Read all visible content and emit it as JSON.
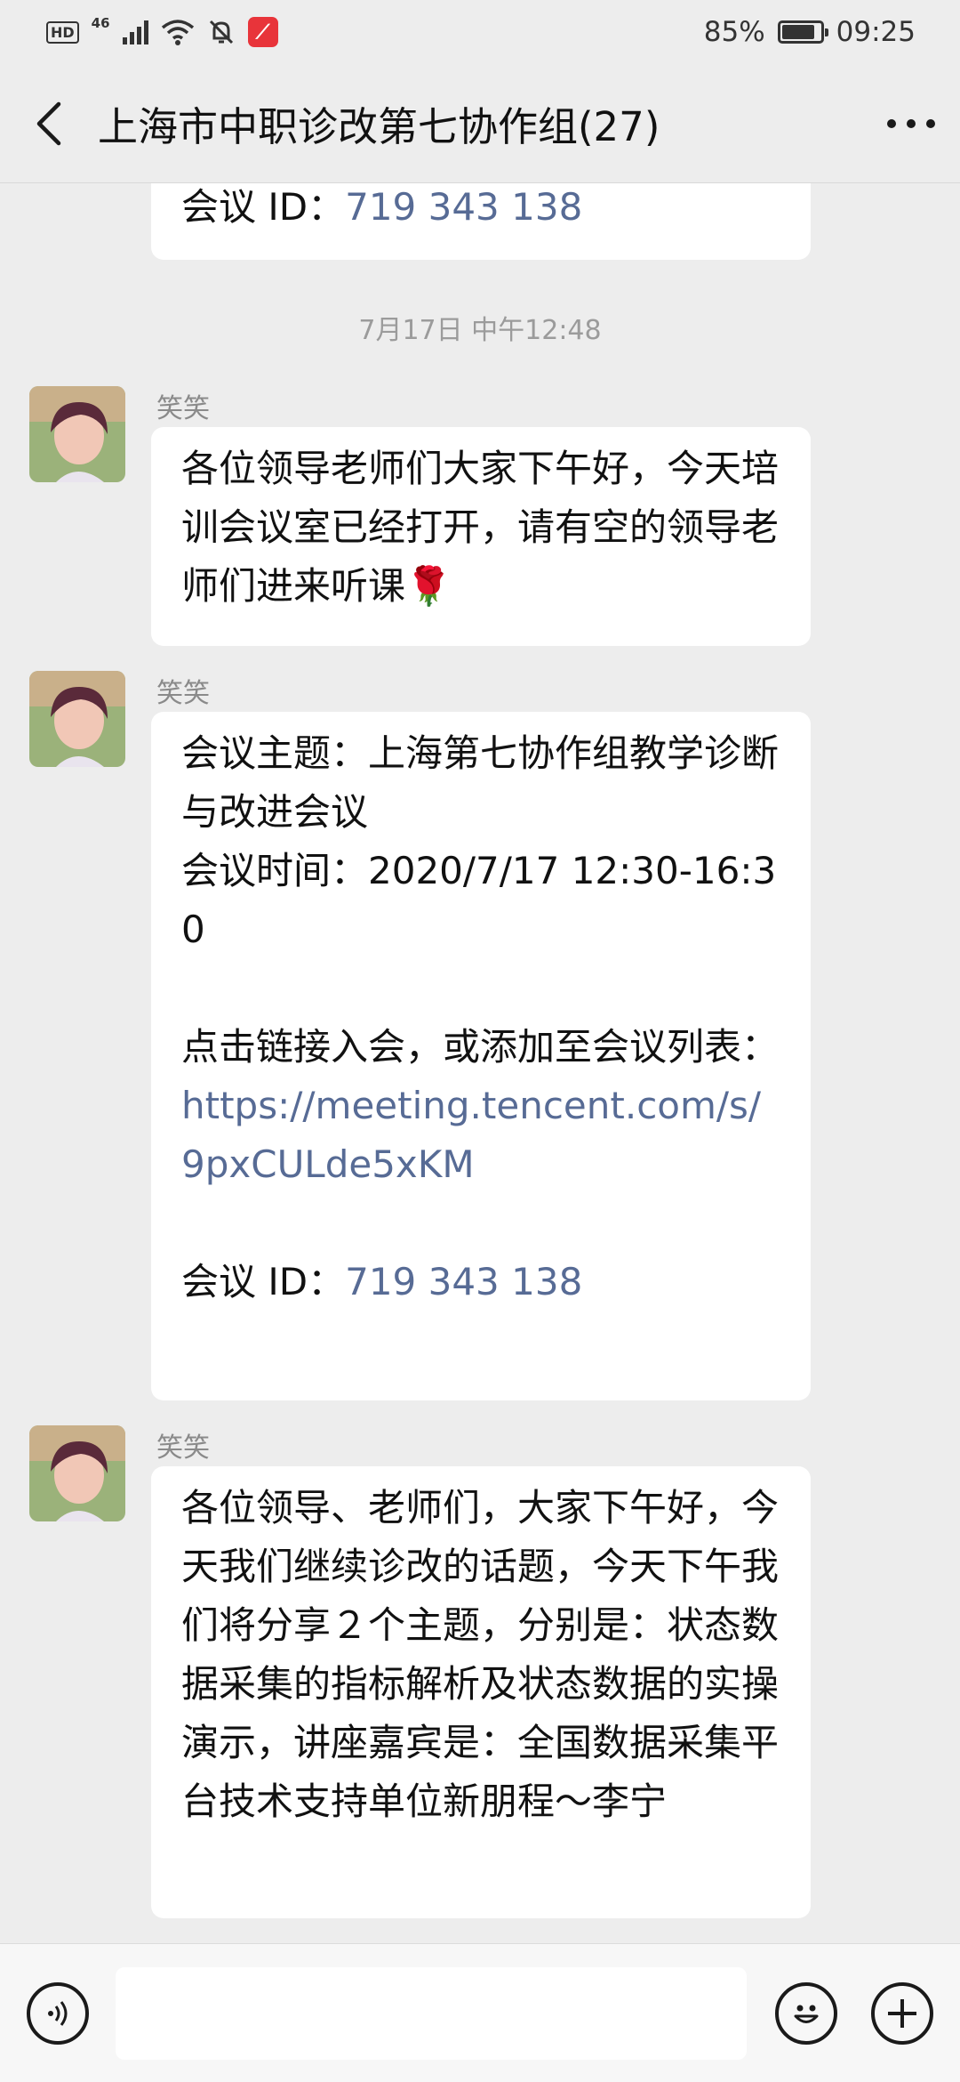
{
  "status_bar": {
    "hd": "HD",
    "network": "46",
    "battery_text": "85%",
    "battery_level": 0.85,
    "time": "09:25"
  },
  "header": {
    "title": "上海市中职诊改第七协作组(27)"
  },
  "chat": {
    "top_partial": {
      "meeting_id_label": "会议 ID：",
      "meeting_id": "719 343 138"
    },
    "timestamp": "7月17日 中午12:48",
    "messages": [
      {
        "sender": "笑笑",
        "text": "各位领导老师们大家下午好，今天培训会议室已经打开，请有空的领导老师们进来听课",
        "emoji": "🌹"
      },
      {
        "sender": "笑笑",
        "line1": "会议主题：上海第七协作组教学诊断与改进会议",
        "line2": "会议时间：2020/7/17 12:30-16:30",
        "line3": "点击链接入会，或添加至会议列表：",
        "link": "https://meeting.tencent.com/s/9pxCULde5xKM",
        "meeting_id_label": "会议 ID：",
        "meeting_id": "719 343 138"
      },
      {
        "sender": "笑笑",
        "text": "各位领导、老师们，大家下午好，今天我们继续诊改的话题，今天下午我们将分享２个主题，分别是：状态数据采集的指标解析及状态数据的实操演示，讲座嘉宾是：全国数据采集平台技术支持单位新朋程～李宁"
      }
    ]
  },
  "icons": {
    "back": "chevron-left-icon",
    "more": "more-dots-icon",
    "voice": "voice-icon",
    "emoji": "emoji-icon",
    "plus": "plus-icon"
  },
  "colors": {
    "background": "#ededed",
    "bubble": "#ffffff",
    "link": "#576b95",
    "app_icon": "#e8343a"
  }
}
